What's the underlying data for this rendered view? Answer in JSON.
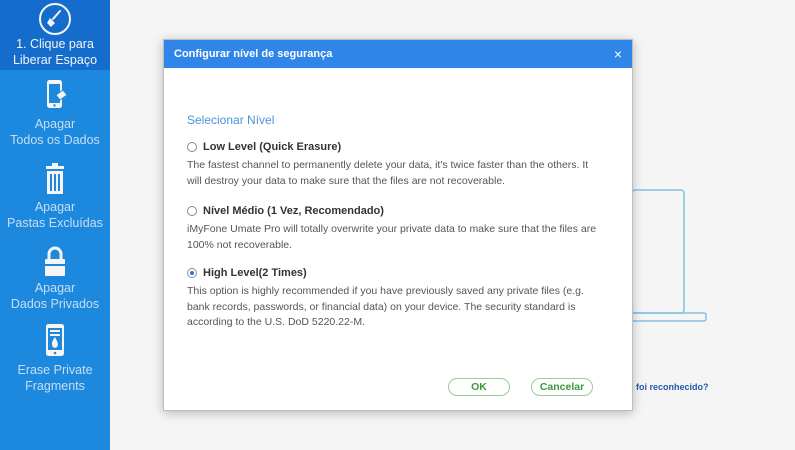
{
  "sidebar": {
    "items": [
      {
        "label_line1": "1. Clique para",
        "label_line2": "Liberar Espaço",
        "icon": "broom-icon",
        "active": true
      },
      {
        "label_line1": "Apagar",
        "label_line2": "Todos os Dados",
        "icon": "phone-eraser-icon",
        "active": false
      },
      {
        "label_line1": "Apagar",
        "label_line2": "Pastas Excluídas",
        "icon": "trash-icon",
        "active": false
      },
      {
        "label_line1": "Apagar",
        "label_line2": "Dados Privados",
        "icon": "lock-icon",
        "active": false
      },
      {
        "label_line1": "Erase Private",
        "label_line2": "Fragments",
        "icon": "phone-fire-icon",
        "active": false
      }
    ]
  },
  "main": {
    "not_recognized_link": "o foi reconhecido?"
  },
  "dialog": {
    "title": "Configurar nível de segurança",
    "close_label": "×",
    "section_title": "Selecionar Nível",
    "options": [
      {
        "title": "Low Level (Quick Erasure)",
        "description": "The fastest channel to permanently delete your data, it's twice faster than the others. It will destroy your data to make sure that the files are not recoverable.",
        "checked": false
      },
      {
        "title": "Nível Médio (1 Vez, Recomendado)",
        "description": "iMyFone Umate Pro will totally overwrite your private data to make sure that the files are 100% not recoverable.",
        "checked": false
      },
      {
        "title": "High Level(2 Times)",
        "description": "This option is highly recommended if you have previously saved any private files (e.g. bank records, passwords, or financial data) on your device. The security standard is according to the U.S. DoD 5220.22-M.",
        "checked": true
      }
    ],
    "ok_label": "OK",
    "cancel_label": "Cancelar"
  },
  "colors": {
    "sidebar_bg": "#1f8fe8",
    "sidebar_active": "#1572d6",
    "dialog_header": "#2f86e8",
    "button_text": "#3a9a3c"
  }
}
